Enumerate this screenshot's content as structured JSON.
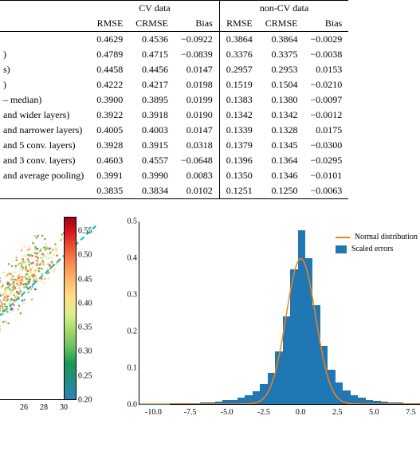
{
  "table": {
    "group_headers": [
      "",
      "CV data",
      "non-CV data"
    ],
    "col_headers": [
      "",
      "RMSE",
      "CRMSE",
      "Bias",
      "RMSE",
      "CRMSE",
      "Bias"
    ],
    "rows": [
      {
        "label": "",
        "cv": [
          "0.4629",
          "0.4536",
          "−0.0922"
        ],
        "nc": [
          "0.3864",
          "0.3864",
          "−0.0029"
        ]
      },
      {
        "label": ")",
        "cv": [
          "0.4789",
          "0.4715",
          "−0.0839"
        ],
        "nc": [
          "0.3376",
          "0.3375",
          "−0.0038"
        ]
      },
      {
        "label": "s)",
        "cv": [
          "0.4458",
          "0.4456",
          "0.0147"
        ],
        "nc": [
          "0.2957",
          "0.2953",
          "0.0153"
        ]
      },
      {
        "label": ")",
        "cv": [
          "0.4222",
          "0.4217",
          "0.0198"
        ],
        "nc": [
          "0.1519",
          "0.1504",
          "−0.0210"
        ]
      },
      {
        "label": " – median)",
        "cv": [
          "0.3900",
          "0.3895",
          "0.0199"
        ],
        "nc": [
          "0.1383",
          "0.1380",
          "−0.0097"
        ]
      },
      {
        "label": " and wider layers)",
        "cv": [
          "0.3922",
          "0.3918",
          "0.0190"
        ],
        "nc": [
          "0.1342",
          "0.1342",
          "−0.0012"
        ]
      },
      {
        "label": " and narrower layers)",
        "cv": [
          "0.4005",
          "0.4003",
          "0.0147"
        ],
        "nc": [
          "0.1339",
          "0.1328",
          "0.0175"
        ]
      },
      {
        "label": " and 5 conv. layers)",
        "cv": [
          "0.3928",
          "0.3915",
          "0.0318"
        ],
        "nc": [
          "0.1379",
          "0.1345",
          "−0.0300"
        ]
      },
      {
        "label": " and 3 conv. layers)",
        "cv": [
          "0.4603",
          "0.4557",
          "−0.0648"
        ],
        "nc": [
          "0.1396",
          "0.1364",
          "−0.0295"
        ]
      },
      {
        "label": " and average pooling)",
        "cv": [
          "0.3991",
          "0.3990",
          "0.0083"
        ],
        "nc": [
          "0.1350",
          "0.1346",
          "−0.0101"
        ]
      },
      {
        "label": "",
        "cv": [
          "0.3835",
          "0.3834",
          "0.0102"
        ],
        "nc": [
          "0.1251",
          "0.1250",
          "−0.0063"
        ]
      }
    ]
  },
  "chart_data": [
    {
      "type": "scatter",
      "note": "partially cropped on left side",
      "xticks_visible": [
        26,
        28,
        30
      ],
      "colorbar_ticks": [
        0.2,
        0.25,
        0.3,
        0.35,
        0.4,
        0.45,
        0.5,
        0.55
      ],
      "colorbar_range": [
        0.2,
        0.58
      ],
      "diag_line": "y=x bisector (cyan, dashed)"
    },
    {
      "type": "histogram",
      "title": "",
      "series_name": "Scaled errors",
      "overlay_name": "Normal distribution",
      "xticks_visible": [
        -10.0,
        -7.5,
        -5.0,
        -2.5,
        0.0,
        2.5,
        5.0,
        7.5
      ],
      "yticks": [
        0.0,
        0.1,
        0.2,
        0.3,
        0.4,
        0.5
      ],
      "ylim": [
        0.0,
        0.5
      ],
      "xlim": [
        -11,
        8.5
      ],
      "bins": [
        {
          "x": -10.5,
          "y": 0.001
        },
        {
          "x": -10.0,
          "y": 0.001
        },
        {
          "x": -9.5,
          "y": 0.001
        },
        {
          "x": -9.0,
          "y": 0.001
        },
        {
          "x": -8.5,
          "y": 0.002
        },
        {
          "x": -8.0,
          "y": 0.002
        },
        {
          "x": -7.5,
          "y": 0.003
        },
        {
          "x": -7.0,
          "y": 0.003
        },
        {
          "x": -6.5,
          "y": 0.004
        },
        {
          "x": -6.0,
          "y": 0.005
        },
        {
          "x": -5.5,
          "y": 0.007
        },
        {
          "x": -5.0,
          "y": 0.01
        },
        {
          "x": -4.5,
          "y": 0.012
        },
        {
          "x": -4.0,
          "y": 0.018
        },
        {
          "x": -3.5,
          "y": 0.025
        },
        {
          "x": -3.0,
          "y": 0.035
        },
        {
          "x": -2.5,
          "y": 0.055
        },
        {
          "x": -2.0,
          "y": 0.085
        },
        {
          "x": -1.5,
          "y": 0.145
        },
        {
          "x": -1.0,
          "y": 0.24
        },
        {
          "x": -0.5,
          "y": 0.37
        },
        {
          "x": 0.0,
          "y": 0.475
        },
        {
          "x": 0.5,
          "y": 0.4
        },
        {
          "x": 1.0,
          "y": 0.27
        },
        {
          "x": 1.5,
          "y": 0.16
        },
        {
          "x": 2.0,
          "y": 0.095
        },
        {
          "x": 2.5,
          "y": 0.06
        },
        {
          "x": 3.0,
          "y": 0.038
        },
        {
          "x": 3.5,
          "y": 0.025
        },
        {
          "x": 4.0,
          "y": 0.018
        },
        {
          "x": 4.5,
          "y": 0.012
        },
        {
          "x": 5.0,
          "y": 0.009
        },
        {
          "x": 5.5,
          "y": 0.007
        },
        {
          "x": 6.0,
          "y": 0.005
        },
        {
          "x": 6.5,
          "y": 0.004
        },
        {
          "x": 7.0,
          "y": 0.003
        },
        {
          "x": 7.5,
          "y": 0.002
        },
        {
          "x": 8.0,
          "y": 0.002
        }
      ]
    }
  ],
  "legend": {
    "line": "Normal distribution",
    "bars": "Scaled errors"
  }
}
